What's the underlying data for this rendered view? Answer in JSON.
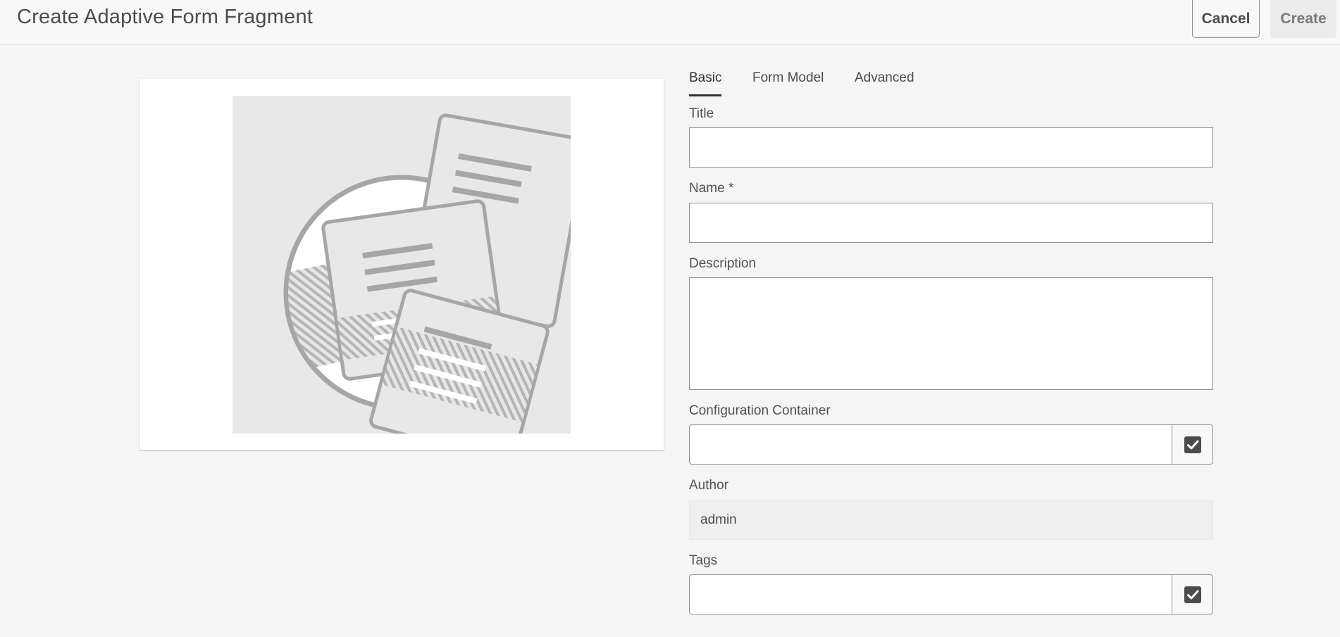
{
  "header": {
    "title": "Create Adaptive Form Fragment",
    "cancel_label": "Cancel",
    "create_label": "Create"
  },
  "tabs": [
    {
      "label": "Basic",
      "active": true
    },
    {
      "label": "Form Model",
      "active": false
    },
    {
      "label": "Advanced",
      "active": false
    }
  ],
  "form": {
    "title_label": "Title",
    "title_value": "",
    "name_label": "Name *",
    "name_value": "",
    "description_label": "Description",
    "description_value": "",
    "config_label": "Configuration Container",
    "config_value": "",
    "author_label": "Author",
    "author_value": "admin",
    "tags_label": "Tags",
    "tags_value": ""
  },
  "icons": {
    "thumbnail": "form-fragment-thumbnail-icon",
    "picker": "checkbox-check-icon"
  },
  "colors": {
    "background": "#f5f5f5",
    "field_border": "#8e8e8e",
    "active_tab": "#323232",
    "illustration": "#a6a6a6"
  }
}
